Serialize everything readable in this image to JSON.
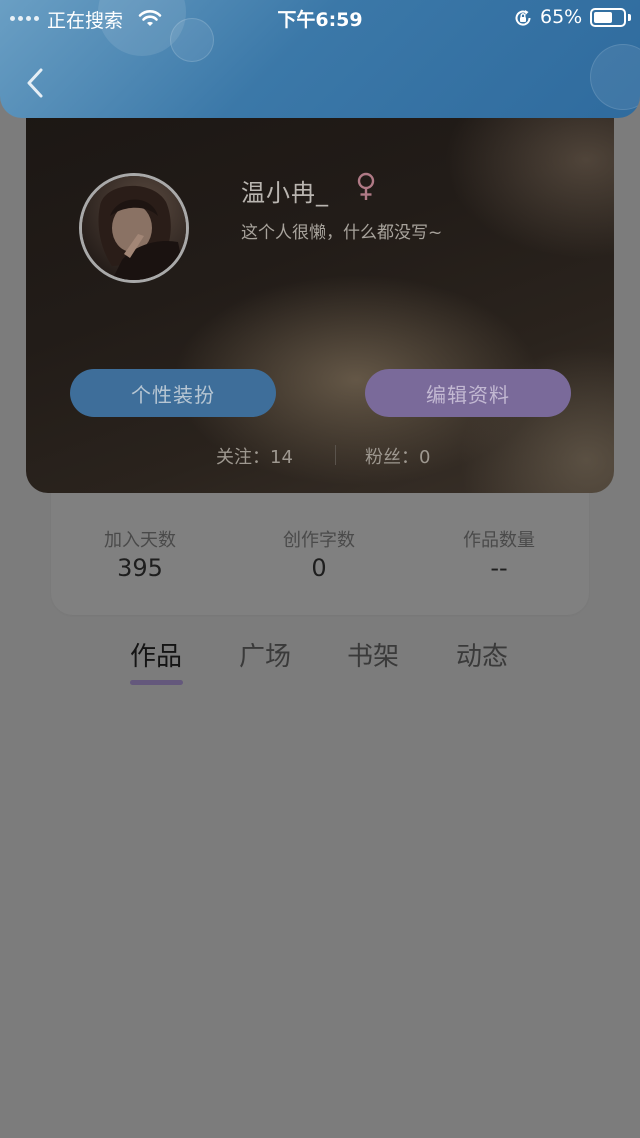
{
  "status_bar": {
    "carrier": "正在搜索",
    "time": "下午6:59",
    "battery_percent": "65%",
    "battery_level": 0.65
  },
  "profile": {
    "username": "温小冉_",
    "gender": "female",
    "bio": "这个人很懒，什么都没写~",
    "dress_up_button": "个性装扮",
    "edit_profile_button": "编辑资料",
    "following": "关注：14",
    "fans": "粉丝：0"
  },
  "stats": [
    {
      "label": "加入天数",
      "value": "395"
    },
    {
      "label": "创作字数",
      "value": "0"
    },
    {
      "label": "作品数量",
      "value": "--"
    }
  ],
  "tabs": [
    {
      "label": "作品",
      "active": true
    },
    {
      "label": "广场",
      "active": false
    },
    {
      "label": "书架",
      "active": false
    },
    {
      "label": "动态",
      "active": false
    }
  ],
  "colors": {
    "header_blue": "#3b78a8",
    "dress_button": "#3e6e9a",
    "edit_button": "#7a6a9a",
    "gender_icon": "#b07a86",
    "tab_indicator": "#64587c",
    "overlay_gray": "#7c7c7c"
  },
  "icons": {
    "back": "chevron-left-icon",
    "gender": "female-symbol-icon",
    "wifi": "wifi-icon",
    "rotation_lock": "rotation-lock-icon",
    "battery": "battery-icon"
  }
}
